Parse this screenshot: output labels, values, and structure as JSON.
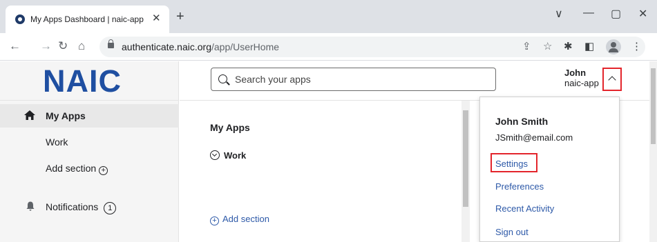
{
  "browser": {
    "tab_title": "My Apps Dashboard | naic-app",
    "tab_close": "✕",
    "new_tab": "+",
    "window_minimize": "—",
    "window_maximize": "▢",
    "window_close": "✕",
    "window_collapse": "∨",
    "url_host": "authenticate.naic.org",
    "url_path": "/app/UserHome"
  },
  "sidebar": {
    "logo": "NAIC",
    "items": [
      {
        "label": "My Apps"
      },
      {
        "label": "Work"
      },
      {
        "label": "Add section"
      },
      {
        "label": "Notifications",
        "count": "1"
      }
    ]
  },
  "header": {
    "search_placeholder": "Search your apps",
    "user_name": "John",
    "user_org": "naic-app"
  },
  "main": {
    "title": "My Apps",
    "section": "Work",
    "add_section": "Add section"
  },
  "dropdown": {
    "full_name": "John Smith",
    "email": "JSmith@email.com",
    "items": [
      "Settings",
      "Preferences",
      "Recent Activity",
      "Sign out"
    ]
  },
  "colors": {
    "brand": "#1f4fa1",
    "link": "#2d59a8",
    "highlight": "#e3242b"
  }
}
